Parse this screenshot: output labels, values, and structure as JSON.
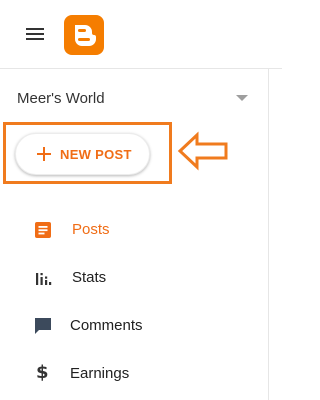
{
  "header": {
    "menu_icon": "hamburger-menu-icon",
    "logo_icon": "blogger-logo-icon",
    "brand_color": "#f57d00"
  },
  "blog_selector": {
    "name": "Meer's World",
    "icon": "caret-down-icon"
  },
  "new_post": {
    "label": "NEW POST",
    "icon": "plus-icon",
    "accent_color": "#f06d16",
    "highlight_color": "#f07b1e"
  },
  "annotation": {
    "icon": "outline-arrow-left-icon",
    "color": "#f07b1e"
  },
  "nav": {
    "items": [
      {
        "label": "Posts",
        "icon": "posts-icon",
        "active": true
      },
      {
        "label": "Stats",
        "icon": "stats-icon",
        "active": false
      },
      {
        "label": "Comments",
        "icon": "comment-icon",
        "active": false
      },
      {
        "label": "Earnings",
        "icon": "dollar-icon",
        "active": false
      }
    ]
  }
}
